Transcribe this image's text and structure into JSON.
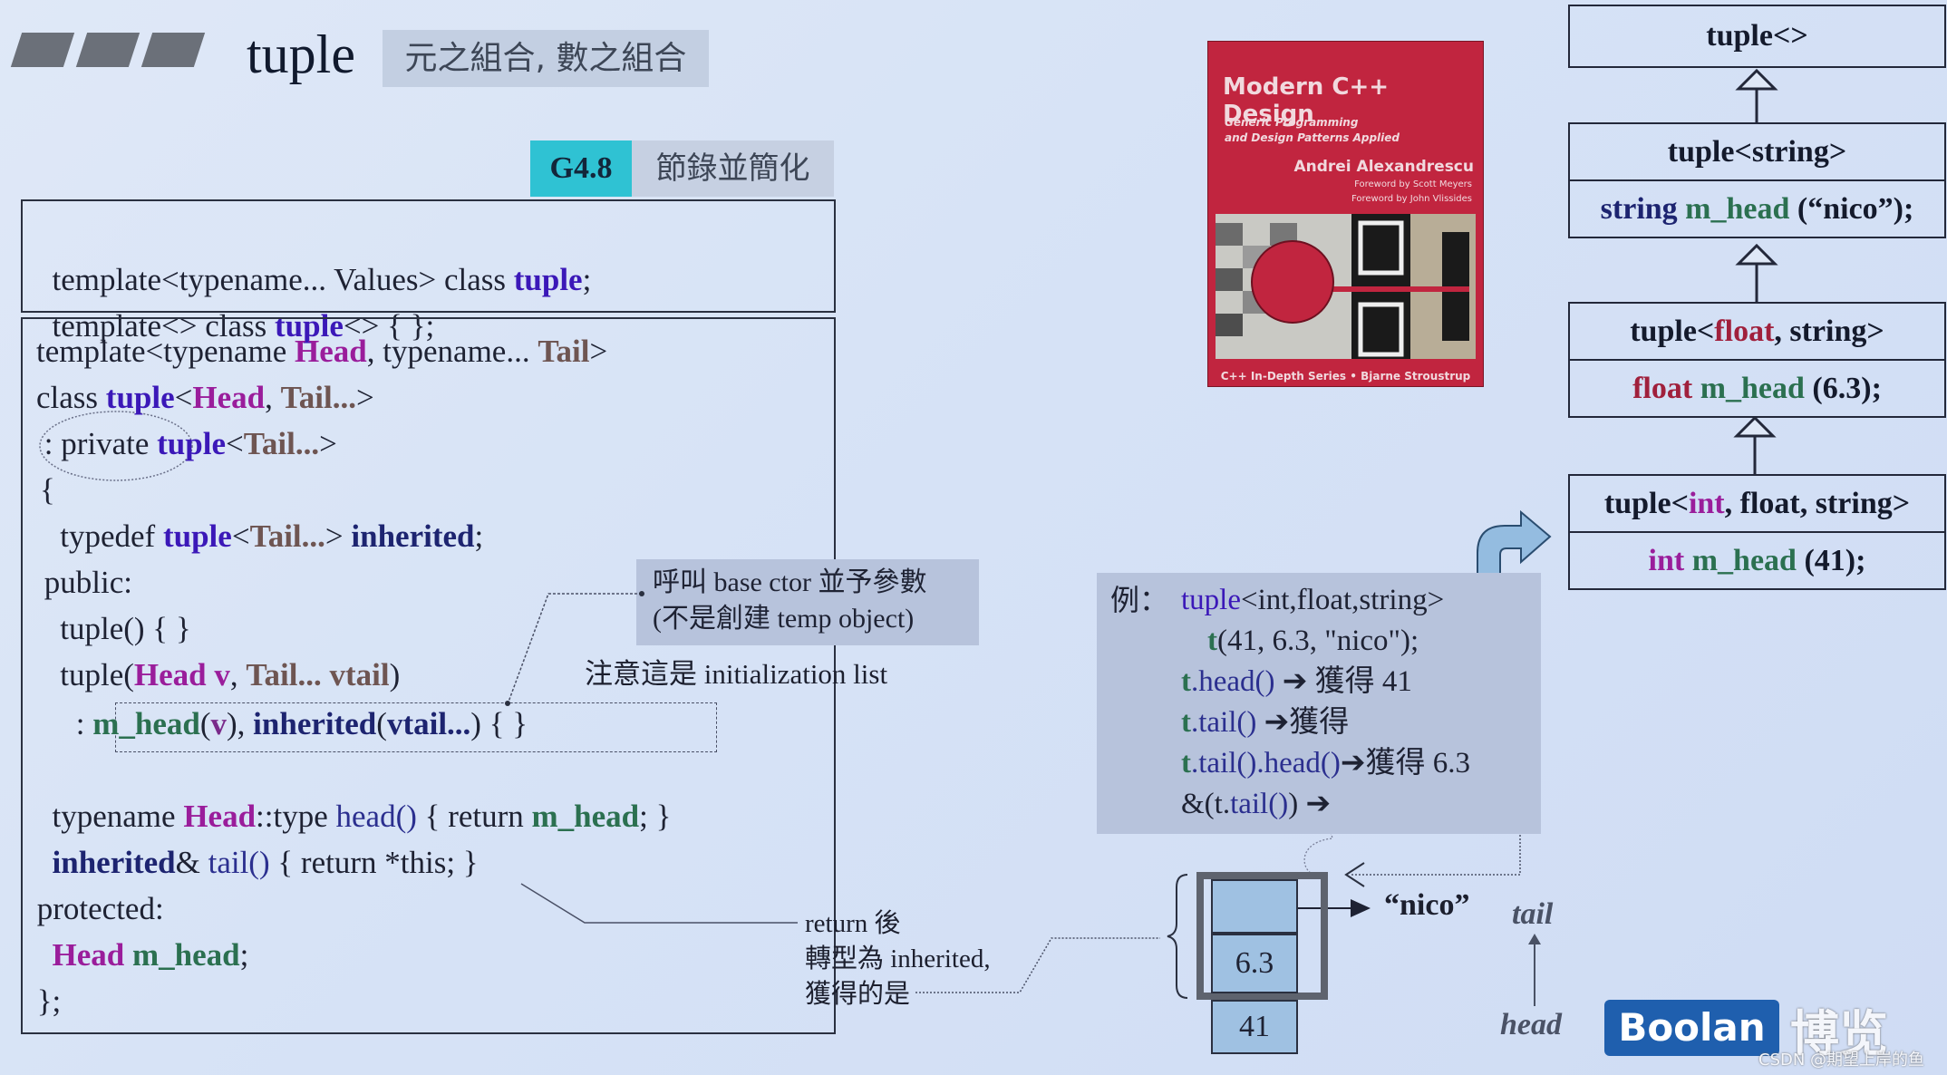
{
  "header": {
    "title": "tuple",
    "subtitle": "元之組合, 數之組合",
    "section_badge": "G4.8",
    "section_note": "節錄並簡化"
  },
  "code_decl": {
    "line1": [
      "template<typename... Values> class ",
      "tuple",
      ";"
    ],
    "line2": [
      "template<> class ",
      "tuple",
      "<> { };"
    ]
  },
  "code_main": {
    "l1": [
      "template<typename ",
      "Head",
      ", typename... ",
      "Tail",
      ">"
    ],
    "l2": [
      "class ",
      "tuple",
      "<",
      "Head",
      ", ",
      "Tail...",
      ">"
    ],
    "l3": [
      " : private ",
      "tuple",
      "<",
      "Tail...",
      ">"
    ],
    "l4": "{",
    "l5": [
      "   typedef ",
      "tuple",
      "<",
      "Tail...",
      "> ",
      "inherited",
      ";"
    ],
    "l6": " public:",
    "l7": "   tuple() { }",
    "l8": [
      "   tuple(",
      "Head v",
      ", ",
      "Tail... vtail",
      ")"
    ],
    "l9": [
      "     : ",
      "m_head",
      "(",
      "v",
      "), ",
      "inherited",
      "(",
      "vtail...",
      ") { }"
    ],
    "l10": [
      "  typename ",
      "Head",
      "::type ",
      "head()",
      " { return ",
      "m_head",
      "; }"
    ],
    "l11": [
      "  ",
      "inherited",
      "& ",
      "tail()",
      " { return *this; }"
    ],
    "l12": " protected:",
    "l13": [
      "  ",
      "Head",
      " ",
      "m_head",
      ";"
    ],
    "l14": " };"
  },
  "annotations": {
    "callout_line1": "呼叫 base ctor 並予參數",
    "callout_line2": "(不是創建 temp object)",
    "init_list_note": "注意這是 initialization list",
    "return_note_line1": "return 後",
    "return_note_line2": "轉型為 inherited,",
    "return_note_line3": "獲得的是"
  },
  "book": {
    "title": "Modern C++ Design",
    "subtitle_line1": "Generic Programming",
    "subtitle_line2": "and Design Patterns Applied",
    "author": "Andrei Alexandrescu",
    "foreword1": "Foreword by Scott Meyers",
    "foreword2": "Foreword by John Vlissides",
    "series": "C++ In-Depth Series • Bjarne Stroustrup"
  },
  "uml": [
    {
      "name": [
        "tuple<>"
      ],
      "member": null
    },
    {
      "name": [
        "tuple<",
        "string",
        ">"
      ],
      "member": [
        "string ",
        "m_head",
        " (“nico”);"
      ]
    },
    {
      "name": [
        "tuple<",
        "float",
        ", string>"
      ],
      "member": [
        "float",
        " ",
        "m_head",
        " (6.3);"
      ]
    },
    {
      "name": [
        "tuple<",
        "int",
        ", float, string>"
      ],
      "member": [
        "int",
        " ",
        "m_head",
        " (41);"
      ]
    }
  ],
  "example": {
    "label": "例：",
    "l1": [
      "tuple",
      "<int,float,string>"
    ],
    "l2": [
      "t",
      "(41, 6.3, \"nico\");"
    ],
    "l3": [
      "t",
      ".head()",
      " ➔ 獲得 41"
    ],
    "l4": [
      "t",
      ".tail()",
      " ➔獲得"
    ],
    "l5": [
      "t",
      ".tail().head()",
      "➔獲得 6.3"
    ],
    "l6": [
      "&(t.",
      "tail()",
      ") ➔"
    ]
  },
  "memory": {
    "cells": [
      "",
      "6.3",
      "41"
    ],
    "pointer_target": "“nico”",
    "tail_label": "tail",
    "head_label": "head"
  },
  "branding": {
    "logo": "Boolan",
    "logo_cn": "博览",
    "watermark": "CSDN @期望上岸的鱼"
  }
}
